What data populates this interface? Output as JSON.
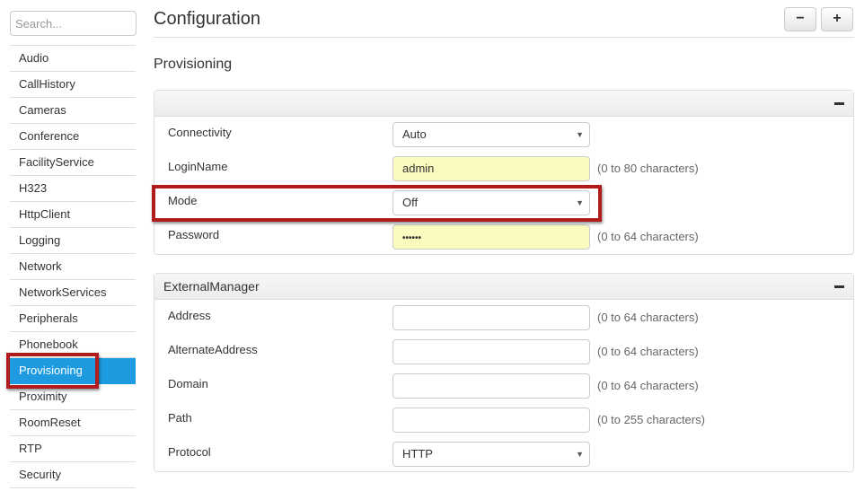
{
  "sidebar": {
    "search_placeholder": "Search...",
    "items": [
      "Audio",
      "CallHistory",
      "Cameras",
      "Conference",
      "FacilityService",
      "H323",
      "HttpClient",
      "Logging",
      "Network",
      "NetworkServices",
      "Peripherals",
      "Phonebook",
      "Provisioning",
      "Proximity",
      "RoomReset",
      "RTP",
      "Security"
    ],
    "active": "Provisioning"
  },
  "header": {
    "title": "Configuration",
    "collapse_all": "−",
    "expand_all": "+"
  },
  "section": {
    "title": "Provisioning"
  },
  "panels": [
    {
      "title": "",
      "rows": [
        {
          "label": "Connectivity",
          "type": "select",
          "value": "Auto",
          "note": ""
        },
        {
          "label": "LoginName",
          "type": "text",
          "value": "admin",
          "note": "(0 to 80 characters)",
          "modified": true
        },
        {
          "label": "Mode",
          "type": "select",
          "value": "Off",
          "note": "",
          "highlighted": true
        },
        {
          "label": "Password",
          "type": "password",
          "value": "••••••",
          "note": "(0 to 64 characters)",
          "modified": true
        }
      ]
    },
    {
      "title": "ExternalManager",
      "rows": [
        {
          "label": "Address",
          "type": "text",
          "value": "",
          "note": "(0 to 64 characters)"
        },
        {
          "label": "AlternateAddress",
          "type": "text",
          "value": "",
          "note": "(0 to 64 characters)"
        },
        {
          "label": "Domain",
          "type": "text",
          "value": "",
          "note": "(0 to 64 characters)"
        },
        {
          "label": "Path",
          "type": "text",
          "value": "",
          "note": "(0 to 255 characters)"
        },
        {
          "label": "Protocol",
          "type": "select",
          "value": "HTTP",
          "note": ""
        }
      ]
    }
  ],
  "colors": {
    "active": "#1e9be0",
    "highlight": "#b01c1c",
    "modified_field": "#fbfbc0"
  },
  "icons": {
    "select_caret": "▼"
  }
}
